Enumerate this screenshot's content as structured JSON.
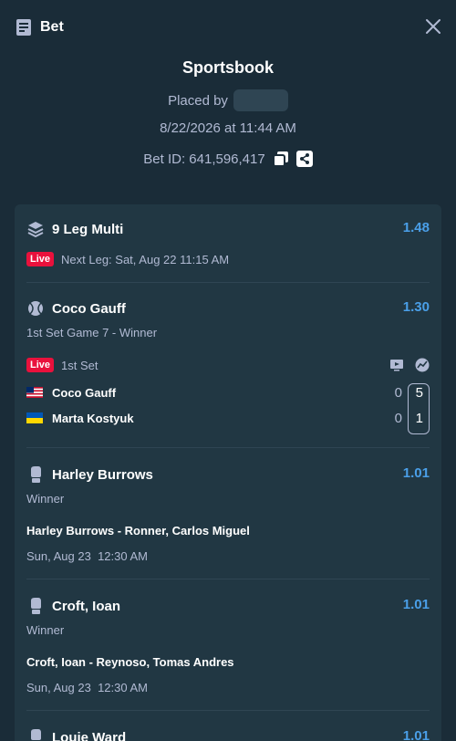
{
  "header": {
    "title": "Bet",
    "icon": "receipt-icon",
    "close_icon": "close-icon"
  },
  "summary": {
    "book": "Sportsbook",
    "placed_by_label": "Placed by",
    "date": "8/22/2026 at 11:44 AM",
    "bet_id": "Bet ID: 641,596,417"
  },
  "multi": {
    "title": "9 Leg Multi",
    "odds": "1.48",
    "live_label": "Live",
    "next_leg": "Next Leg: Sat, Aug 22 11:15 AM"
  },
  "legs": [
    {
      "name": "Coco Gauff",
      "odds": "1.30",
      "market": "1st Set Game 7 - Winner",
      "live_label": "Live",
      "period": "1st Set",
      "players": [
        {
          "name": "Coco Gauff",
          "flag": "us-flag",
          "games": "0",
          "set": "5"
        },
        {
          "name": "Marta Kostyuk",
          "flag": "ua-flag",
          "games": "0",
          "set": "1"
        }
      ]
    },
    {
      "name": "Harley Burrows",
      "odds": "1.01",
      "market": "Winner",
      "match": "Harley Burrows - Ronner, Carlos Miguel",
      "time": "Sun, Aug 23  12:30 AM"
    },
    {
      "name": "Croft, Ioan",
      "odds": "1.01",
      "market": "Winner",
      "match": "Croft, Ioan - Reynoso, Tomas Andres",
      "time": "Sun, Aug 23  12:30 AM"
    },
    {
      "name": "Louie Ward",
      "odds": "1.01"
    }
  ],
  "colors": {
    "background": "#1a2c38",
    "card": "#213743",
    "odds": "#4a9fe8",
    "live": "#e9113c",
    "muted": "#b1bad3"
  }
}
